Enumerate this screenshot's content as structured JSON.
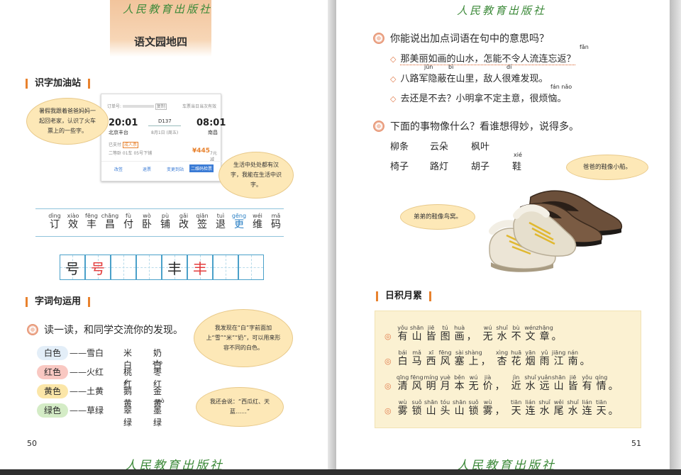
{
  "publisher": "人民教育出版社",
  "left": {
    "header_title": "语文园地四",
    "sec1_title": "识字加油站",
    "bubble_note1": "暑假我跟着爸爸妈妈一起回老家，认识了火车票上的一些字。",
    "bubble_note2": "生活中处处都有汉字，我能在生活中识字。",
    "ticket": {
      "order_label": "订单号:",
      "order_tag": "复制",
      "stub": "车票当日当次有效",
      "dep_time": "20:01",
      "dep_station": "北京丰台",
      "train": "D137",
      "date": "8月1日 (周五)",
      "arr_time": "08:01",
      "arr_day": "+1",
      "arr_station": "南昌",
      "paid": "已支付",
      "adult": "成人票",
      "seat": "二等卧 01车 05号下铺",
      "price": "¥445",
      "price_note": "7元减",
      "btn_change": "改签",
      "btn_refund": "退票",
      "btn_dest": "变更到站",
      "btn_qr": "二维码检票"
    },
    "pinyin_chars": [
      {
        "py": "dìng",
        "hz": "订"
      },
      {
        "py": "xiào",
        "hz": "效"
      },
      {
        "py": "fēng",
        "hz": "丰"
      },
      {
        "py": "chāng",
        "hz": "昌"
      },
      {
        "py": "fù",
        "hz": "付"
      },
      {
        "py": "wò",
        "hz": "卧"
      },
      {
        "py": "pù",
        "hz": "铺"
      },
      {
        "py": "gǎi",
        "hz": "改"
      },
      {
        "py": "qiān",
        "hz": "签"
      },
      {
        "py": "tuì",
        "hz": "退"
      },
      {
        "py": "gēng",
        "hz": "更"
      },
      {
        "py": "wéi",
        "hz": "维"
      },
      {
        "py": "mǎ",
        "hz": "码"
      }
    ],
    "grid1_char": "号",
    "grid2_char": "丰",
    "sec2_title": "字词句运用",
    "instruction": "读一读，和同学交流你的发现。",
    "bubble_note3": "我发现在“白”字前面加上“雪”“米”“奶”，可以用来形容不同的白色。",
    "bubble_note4": "我还会说：“西瓜红、天蓝……”",
    "colors": [
      {
        "label": "白色",
        "w1": "——雪白",
        "w2": "米白",
        "w3": "奶白",
        "py3": ""
      },
      {
        "label": "红色",
        "w1": "——火红",
        "w2": "桃红",
        "w3": "枣红",
        "py3": "zǎo"
      },
      {
        "label": "黄色",
        "w1": "——土黄",
        "w2": "鹅黄",
        "w3": "金黄",
        "py2": "é"
      },
      {
        "label": "绿色",
        "w1": "——草绿",
        "w2": "翠绿",
        "w3": "墨绿",
        "py3": "mò"
      }
    ],
    "page_num": "50"
  },
  "right": {
    "q1": "你能说出加点词语在句中的意思吗？",
    "q1_items": [
      "那美丽如画的山水，怎能不令人流连忘返？",
      "八路军隐蔽在山里，敌人很难发现。",
      "去还是不去？小明拿不定主意，很烦恼。"
    ],
    "q1_py": {
      "fan": "fǎn",
      "jun": "jūn",
      "bi": "bì",
      "di": "dí",
      "fannao": "fán nǎo"
    },
    "q2": "下面的事物像什么？看谁想得妙，说得多。",
    "q2_row1": [
      "柳条",
      "云朵",
      "枫叶"
    ],
    "q2_row2": [
      "椅子",
      "路灯",
      "胡子",
      "鞋"
    ],
    "q2_py_xie": "xié",
    "bubble_dad": "爸爸的鞋像小船。",
    "bubble_bro": "弟弟的鞋像鸟窝。",
    "sec3_title": "日积月累",
    "poem": [
      {
        "a": [
          [
            "yǒu",
            "有"
          ],
          [
            "shān",
            "山"
          ],
          [
            "jiē",
            "皆"
          ],
          [
            "tú",
            "图"
          ],
          [
            "huà",
            "画"
          ]
        ],
        "b": [
          [
            "wú",
            "无"
          ],
          [
            "shuǐ",
            "水"
          ],
          [
            "bù",
            "不"
          ],
          [
            "wén",
            "文"
          ],
          [
            "zhāng",
            "章"
          ]
        ]
      },
      {
        "a": [
          [
            "bái",
            "白"
          ],
          [
            "mǎ",
            "马"
          ],
          [
            "xī",
            "西"
          ],
          [
            "fēng",
            "风"
          ],
          [
            "sài",
            "塞"
          ],
          [
            "shàng",
            "上"
          ]
        ],
        "b": [
          [
            "xìng",
            "杏"
          ],
          [
            "huā",
            "花"
          ],
          [
            "yān",
            "烟"
          ],
          [
            "yǔ",
            "雨"
          ],
          [
            "jiāng",
            "江"
          ],
          [
            "nán",
            "南"
          ]
        ]
      },
      {
        "a": [
          [
            "qīng",
            "清"
          ],
          [
            "fēng",
            "风"
          ],
          [
            "míng",
            "明"
          ],
          [
            "yuè",
            "月"
          ],
          [
            "běn",
            "本"
          ],
          [
            "wú",
            "无"
          ],
          [
            "jià",
            "价"
          ]
        ],
        "b": [
          [
            "jìn",
            "近"
          ],
          [
            "shuǐ",
            "水"
          ],
          [
            "yuǎn",
            "远"
          ],
          [
            "shān",
            "山"
          ],
          [
            "jiē",
            "皆"
          ],
          [
            "yǒu",
            "有"
          ],
          [
            "qíng",
            "情"
          ]
        ]
      },
      {
        "a": [
          [
            "wù",
            "雾"
          ],
          [
            "suǒ",
            "锁"
          ],
          [
            "shān",
            "山"
          ],
          [
            "tóu",
            "头"
          ],
          [
            "shān",
            "山"
          ],
          [
            "suǒ",
            "锁"
          ],
          [
            "wù",
            "雾"
          ]
        ],
        "b": [
          [
            "tiān",
            "天"
          ],
          [
            "lián",
            "连"
          ],
          [
            "shuǐ",
            "水"
          ],
          [
            "wěi",
            "尾"
          ],
          [
            "shuǐ",
            "水"
          ],
          [
            "lián",
            "连"
          ],
          [
            "tiān",
            "天"
          ]
        ]
      }
    ],
    "page_num": "51"
  },
  "colors": {
    "accent": "#e8822e",
    "logo": "#3d8a3a",
    "bubble": "#fde8b7",
    "grid": "#4aa0c9",
    "red_char": "#e33b3b"
  }
}
